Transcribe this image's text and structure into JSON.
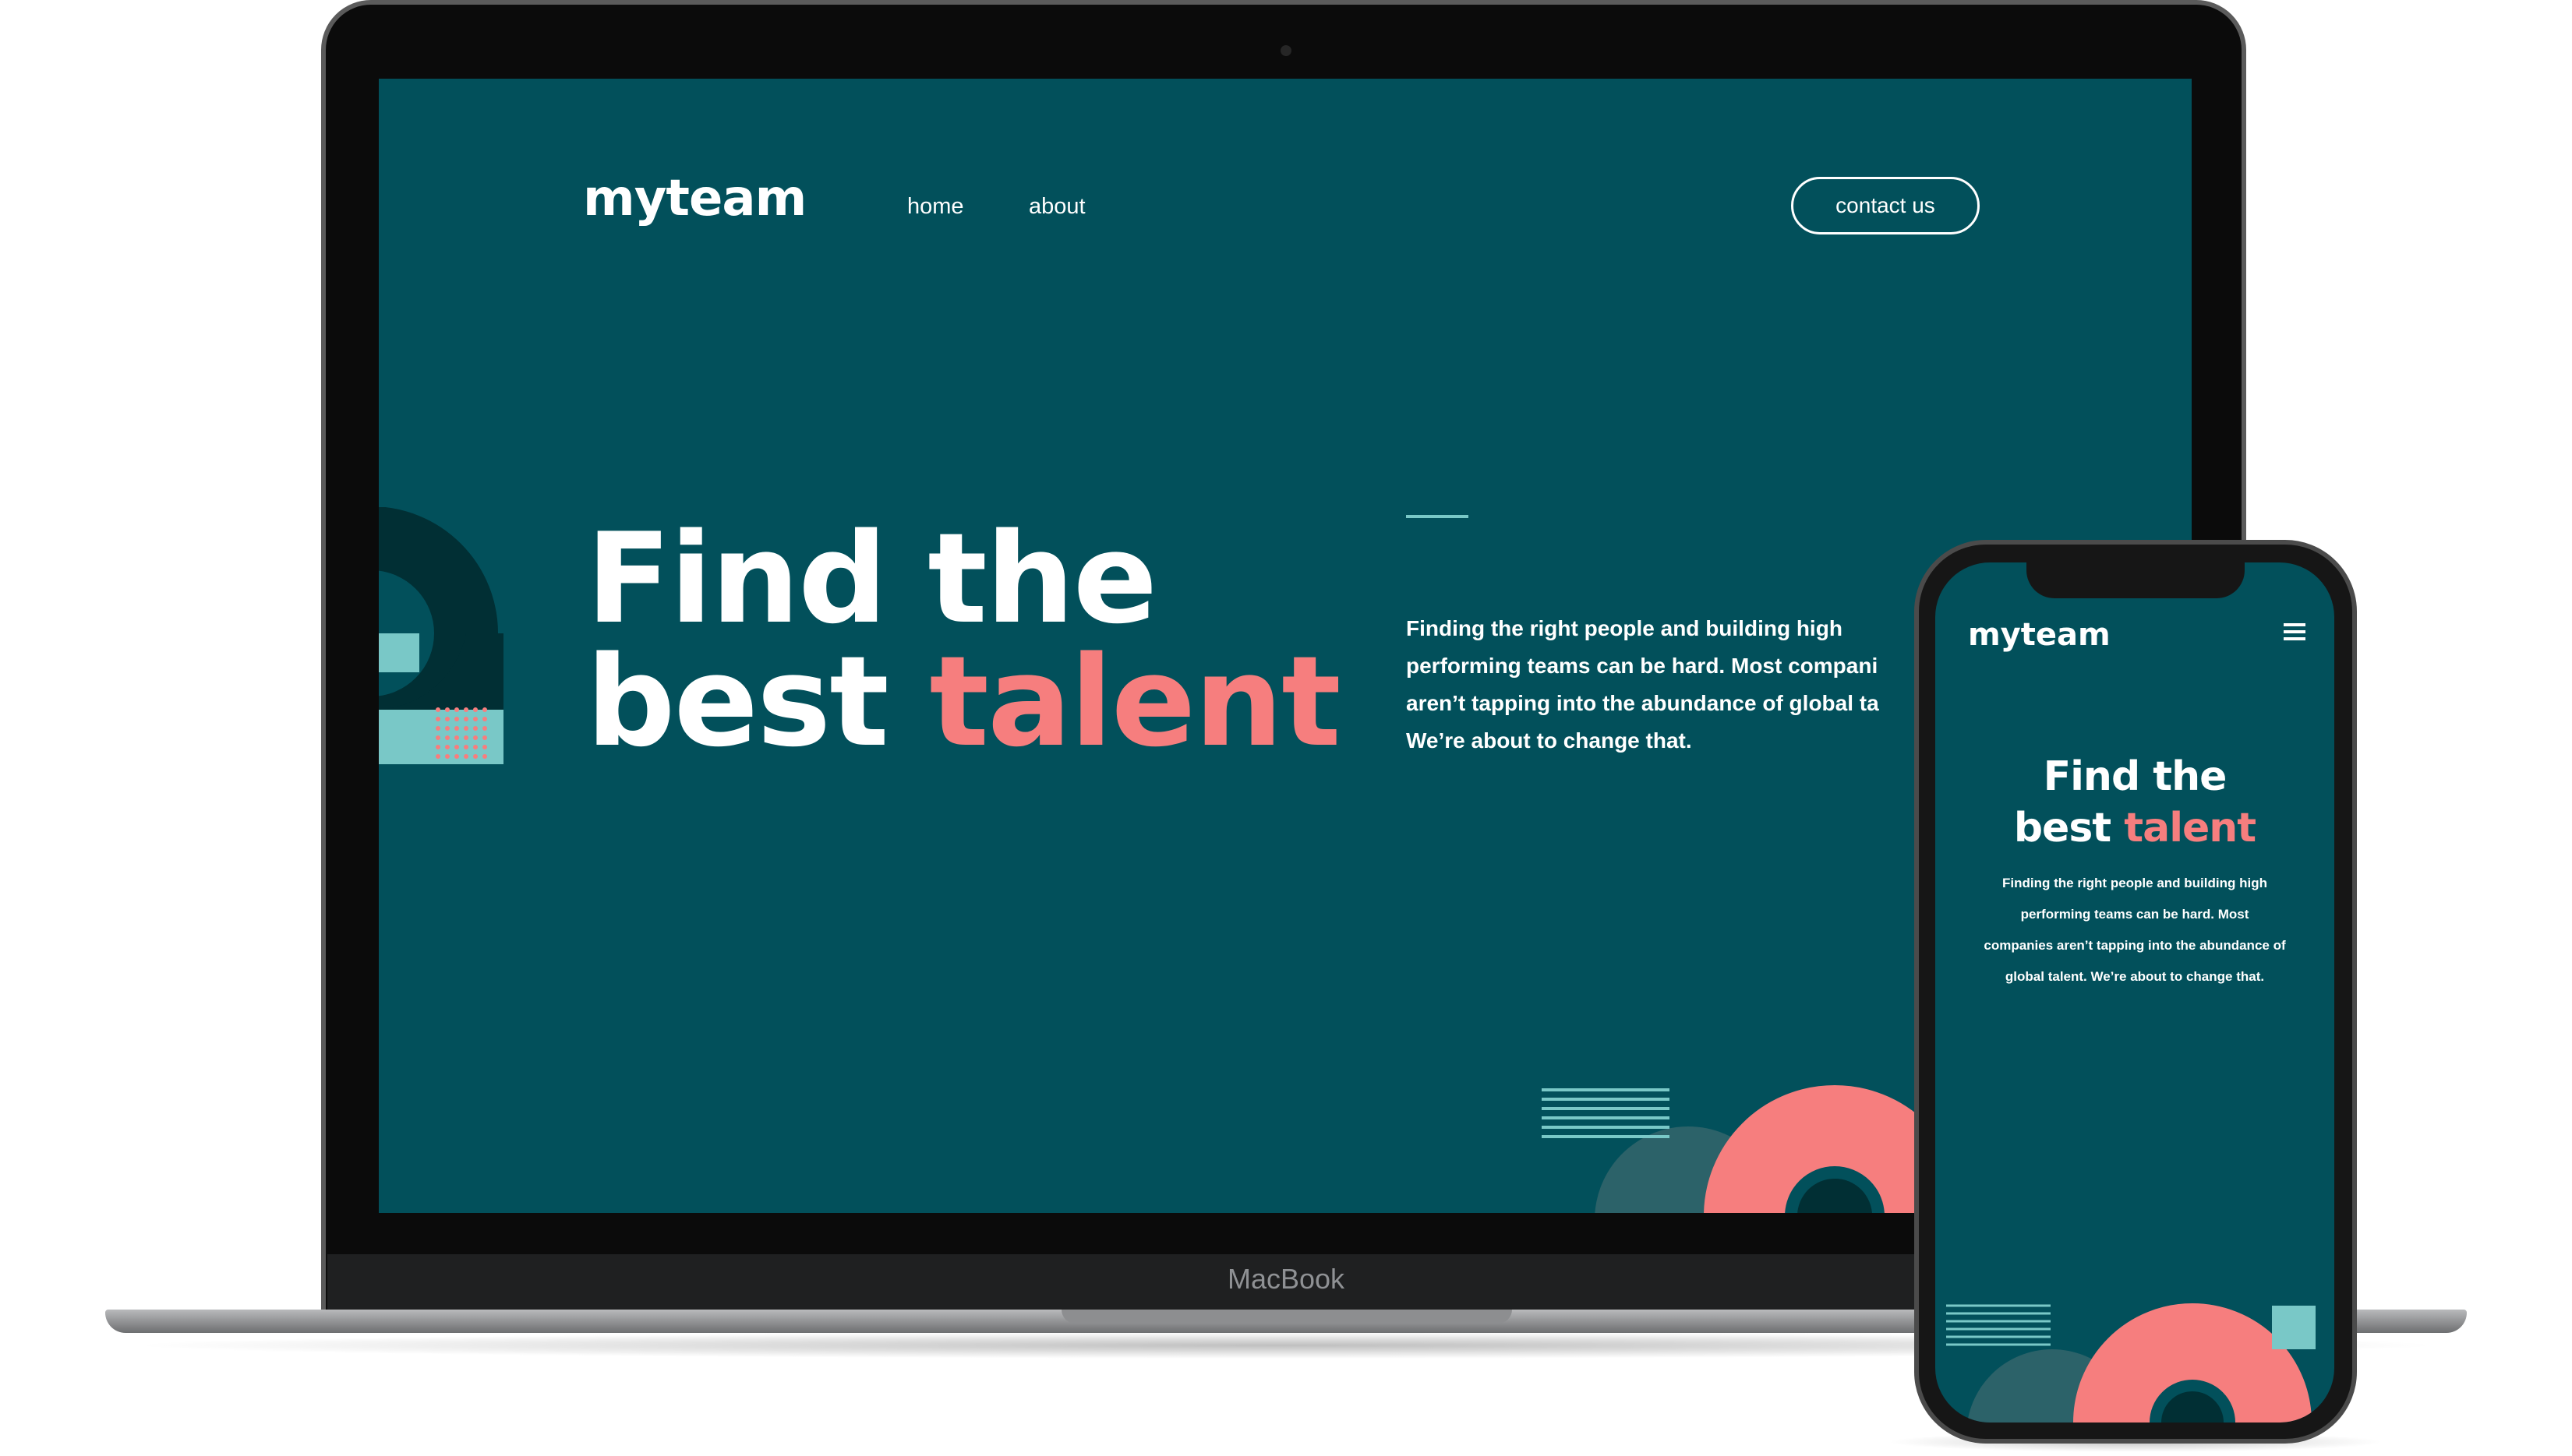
{
  "laptop": {
    "brand_label": "MacBook",
    "site": {
      "logo": "myteam",
      "nav": [
        "home",
        "about"
      ],
      "contact_button": "contact us",
      "hero_line1": "Find the",
      "hero_line2_start": "best",
      "hero_line2_accent": "talent",
      "description": {
        "line1": "Finding the right people and building high",
        "line2": "performing teams can be hard. Most compani",
        "line3": "aren’t tapping into the abundance of global ta",
        "line4": "We’re about to change that."
      }
    }
  },
  "phone": {
    "site": {
      "logo": "myteam",
      "menu_icon": "hamburger-menu-icon",
      "hero_line1": "Find the",
      "hero_line2_start": "best",
      "hero_line2_accent": "talent",
      "description": {
        "line1": "Finding the right people and building high",
        "line2": "performing teams can be hard. Most",
        "line3": "companies aren’t tapping into the abundance of",
        "line4": "global talent. We’re about to change that."
      }
    }
  },
  "colors": {
    "background": "#02505b",
    "accent": "#f67e7e",
    "light_teal": "#79c8c7",
    "dark_teal": "#012f34",
    "mid_teal": "#2c6269"
  }
}
